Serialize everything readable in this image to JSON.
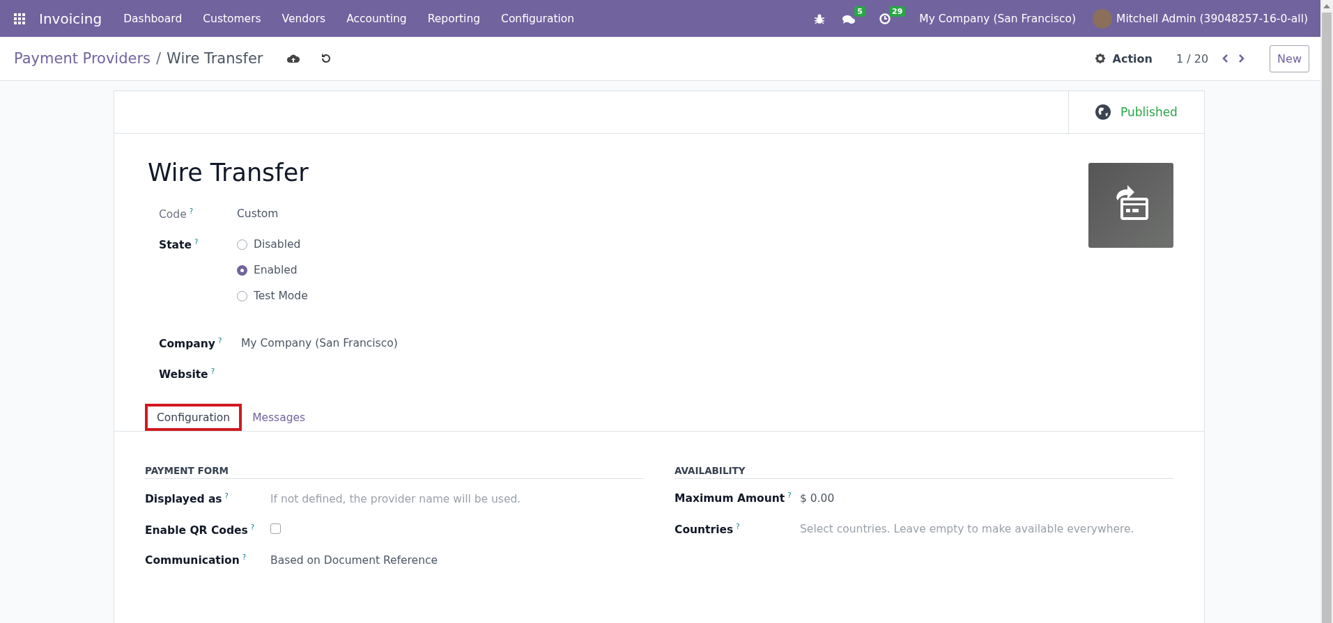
{
  "navbar": {
    "app": "Invoicing",
    "menu": [
      "Dashboard",
      "Customers",
      "Vendors",
      "Accounting",
      "Reporting",
      "Configuration"
    ],
    "messages_count": "5",
    "activities_count": "29",
    "company": "My Company (San Francisco)",
    "user": "Mitchell Admin (39048257-16-0-all)"
  },
  "control_panel": {
    "breadcrumb": [
      {
        "label": "Payment Providers",
        "kind": "link"
      },
      {
        "label": "Wire Transfer",
        "kind": "current"
      }
    ],
    "separator": "/",
    "action": "Action",
    "pager": "1 / 20",
    "new_button": "New"
  },
  "button_box": [
    {
      "label": "Published",
      "color": "#28a745"
    }
  ],
  "record": {
    "title": "Wire Transfer",
    "fields": [
      {
        "kind": "text",
        "label": "Code",
        "tooltip": "?",
        "value": "Custom",
        "readonly": true
      },
      {
        "kind": "radio",
        "label": "State",
        "tooltip": "?",
        "options": [
          {
            "label": "Disabled",
            "selected": false
          },
          {
            "label": "Enabled",
            "selected": true
          },
          {
            "label": "Test Mode",
            "selected": false
          }
        ]
      },
      {
        "kind": "text",
        "label": "Company",
        "tooltip": "?",
        "value": "My Company (San Francisco)",
        "readonly": false
      },
      {
        "kind": "text",
        "label": "Website",
        "tooltip": "?",
        "readonly": false
      }
    ]
  },
  "tabs": [
    {
      "label": "Configuration",
      "selected": true,
      "highlighted": true
    },
    {
      "label": "Messages",
      "selected": false,
      "highlighted": false
    }
  ],
  "sections": [
    {
      "title": "PAYMENT FORM",
      "fields": [
        {
          "kind": "input",
          "label": "Displayed as",
          "tooltip": "?",
          "placeholder": "If not defined, the provider name will be used."
        },
        {
          "kind": "checkbox",
          "label": "Enable QR Codes",
          "tooltip": "?",
          "checked": false
        },
        {
          "kind": "text",
          "label": "Communication",
          "tooltip": "?",
          "value": "Based on Document Reference"
        }
      ]
    },
    {
      "title": "AVAILABILITY",
      "fields": [
        {
          "kind": "text",
          "label": "Maximum Amount",
          "tooltip": "?",
          "value": "$ 0.00"
        },
        {
          "kind": "input",
          "label": "Countries",
          "tooltip": "?",
          "placeholder": "Select countries. Leave empty to make available everywhere."
        }
      ]
    }
  ]
}
